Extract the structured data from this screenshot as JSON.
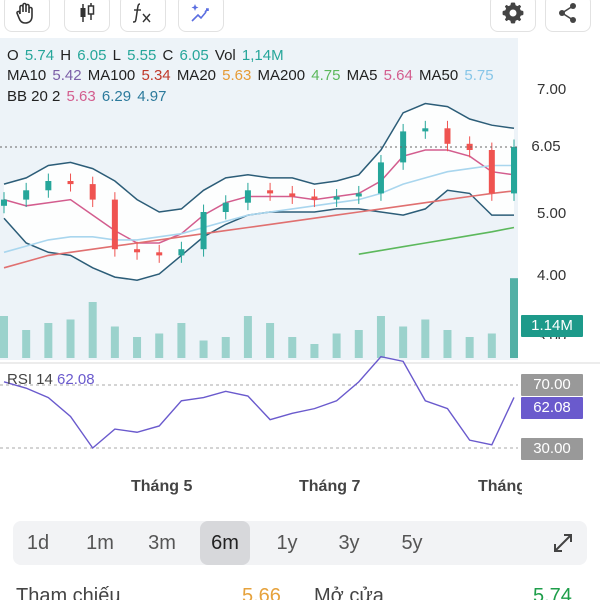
{
  "toolbar": {
    "left_icons": [
      "hand-pan-icon",
      "candlestick-icon",
      "formula-icon",
      "magic-draw-icon"
    ],
    "right_icons": [
      "gear-icon",
      "share-icon"
    ]
  },
  "ohlc": {
    "o_label": "O",
    "o": "5.74",
    "h_label": "H",
    "h": "6.05",
    "l_label": "L",
    "l": "5.55",
    "c_label": "C",
    "c": "6.05",
    "vol_label": "Vol",
    "vol": "1,14M"
  },
  "ma": [
    {
      "label": "MA10",
      "value": "5.42",
      "color": "#7b5ea7"
    },
    {
      "label": "MA100",
      "value": "5.34",
      "color": "#c0392b"
    },
    {
      "label": "MA20",
      "value": "5.63",
      "color": "#e69b35"
    },
    {
      "label": "MA200",
      "value": "4.75",
      "color": "#5cb85c"
    },
    {
      "label": "MA5",
      "value": "5.64",
      "color": "#d35d8e"
    },
    {
      "label": "MA50",
      "value": "5.75",
      "color": "#87c6e8"
    }
  ],
  "bb": {
    "label": "BB 20 2",
    "mid": "5.63",
    "upper": "6.29",
    "lower": "4.97",
    "colors": {
      "mid": "#d35d8e",
      "upper": "#2c7a9c",
      "lower": "#2c7a9c"
    }
  },
  "price_axis": {
    "labels": [
      "7.00",
      "5.00",
      "4.00",
      "3.00"
    ],
    "current_price": "6.05",
    "volume": "1.14M"
  },
  "rsi": {
    "label": "RSI 14",
    "value": "62.08",
    "upper": "70.00",
    "lower": "30.00",
    "color": "#6a5acd"
  },
  "months": [
    "Tháng 5",
    "Tháng 7",
    "Tháng"
  ],
  "ranges": [
    "1d",
    "1m",
    "3m",
    "6m",
    "1y",
    "3y",
    "5y"
  ],
  "active_range": "6m",
  "footer": {
    "ref_label": "Tham chiếu",
    "ref_value": "5.66",
    "open_label": "Mở cửa",
    "open_value": "5.74"
  },
  "colors": {
    "up": "#26a69a",
    "down": "#ef5350",
    "accent_up": "#1e9e4a",
    "price_tag": "#1d9a8a",
    "rsi_tag": "#888888"
  },
  "chart_data": {
    "type": "line",
    "ylim": [
      3.0,
      7.2
    ],
    "series": [
      {
        "name": "BB upper",
        "values": [
          5.45,
          5.55,
          5.75,
          5.8,
          5.7,
          5.5,
          5.2,
          5.0,
          5.05,
          5.35,
          5.55,
          5.6,
          5.55,
          5.55,
          5.45,
          5.5,
          5.6,
          6.0,
          6.6,
          6.75,
          6.7,
          6.5,
          6.4,
          6.35
        ]
      },
      {
        "name": "BB lower",
        "values": [
          4.9,
          4.5,
          4.35,
          4.3,
          4.1,
          3.95,
          3.9,
          4.0,
          4.3,
          4.6,
          4.8,
          4.95,
          5.0,
          5.0,
          5.0,
          5.05,
          5.05,
          5.0,
          4.95,
          5.05,
          5.35,
          5.3,
          4.95,
          4.95
        ]
      },
      {
        "name": "BB mid",
        "values": [
          5.2,
          5.1,
          5.15,
          5.2,
          4.95,
          4.7,
          4.5,
          4.5,
          4.65,
          4.95,
          5.15,
          5.25,
          5.25,
          5.25,
          5.2,
          5.25,
          5.3,
          5.5,
          5.9,
          6.0,
          6.0,
          5.9,
          5.65,
          5.6
        ]
      },
      {
        "name": "MA100",
        "values": [
          4.1,
          4.2,
          4.3,
          4.35,
          4.4,
          4.45,
          4.5,
          4.55,
          4.6,
          4.65,
          4.7,
          4.75,
          4.8,
          4.85,
          4.9,
          4.95,
          5.0,
          5.05,
          5.1,
          5.15,
          5.2,
          5.25,
          5.3,
          5.34
        ]
      },
      {
        "name": "MA50",
        "values": [
          4.35,
          4.45,
          4.55,
          4.6,
          4.6,
          4.55,
          4.55,
          4.6,
          4.65,
          4.75,
          4.85,
          4.95,
          5.0,
          5.05,
          5.1,
          5.15,
          5.2,
          5.3,
          5.45,
          5.55,
          5.65,
          5.7,
          5.75,
          5.75
        ]
      },
      {
        "name": "MA200",
        "values": [
          null,
          null,
          null,
          null,
          null,
          null,
          null,
          null,
          null,
          null,
          null,
          null,
          null,
          null,
          null,
          null,
          4.32,
          4.38,
          4.44,
          4.5,
          4.56,
          4.62,
          4.68,
          4.75
        ]
      }
    ],
    "candles_close": [
      5.2,
      5.35,
      5.5,
      5.45,
      5.2,
      4.4,
      4.35,
      4.3,
      4.4,
      5.0,
      5.15,
      5.35,
      5.3,
      5.25,
      5.2,
      5.25,
      5.3,
      5.8,
      6.3,
      6.35,
      6.1,
      6.0,
      5.3,
      6.05
    ],
    "volume": [
      0.6,
      0.4,
      0.5,
      0.55,
      0.8,
      0.45,
      0.3,
      0.35,
      0.5,
      0.25,
      0.3,
      0.6,
      0.5,
      0.3,
      0.2,
      0.35,
      0.4,
      0.6,
      0.45,
      0.55,
      0.4,
      0.3,
      0.35,
      1.14
    ],
    "rsi": [
      72,
      68,
      62,
      50,
      30,
      42,
      40,
      44,
      60,
      62,
      66,
      63,
      48,
      52,
      55,
      60,
      72,
      88,
      85,
      60,
      55,
      35,
      32,
      62.08
    ]
  }
}
